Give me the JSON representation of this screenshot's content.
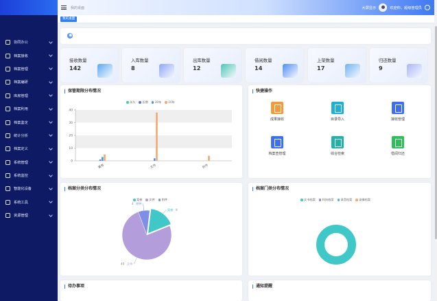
{
  "sidebar": {
    "items": [
      {
        "label": "协同办公",
        "icon": "settings-icon"
      },
      {
        "label": "档案接收",
        "icon": "inbox-icon"
      },
      {
        "label": "档案管理",
        "icon": "archive-icon"
      },
      {
        "label": "档案编研",
        "icon": "edit-icon"
      },
      {
        "label": "库房管理",
        "icon": "warehouse-icon"
      },
      {
        "label": "档案利用",
        "icon": "use-icon"
      },
      {
        "label": "档案鉴定",
        "icon": "appraise-icon"
      },
      {
        "label": "统计分析",
        "icon": "stats-icon"
      },
      {
        "label": "档案定义",
        "icon": "define-icon"
      },
      {
        "label": "系统管理",
        "icon": "system-icon"
      },
      {
        "label": "系统监控",
        "icon": "monitor-icon"
      },
      {
        "label": "智能化设备",
        "icon": "device-icon"
      },
      {
        "label": "系统工具",
        "icon": "tools-icon"
      },
      {
        "label": "资源管理",
        "icon": "resource-icon"
      }
    ]
  },
  "topbar": {
    "breadcrumb": "我的桌面",
    "bigscreen": "大屏显示",
    "welcome": "欢迎你，超级管理员"
  },
  "tabs": [
    {
      "label": "我的桌面"
    }
  ],
  "stats": [
    {
      "label": "接收数量",
      "value": "142",
      "color": "#5aa9f0"
    },
    {
      "label": "入库数量",
      "value": "8",
      "color": "#8fa6f6"
    },
    {
      "label": "出库数量",
      "value": "12",
      "color": "#4cc7b7"
    },
    {
      "label": "借阅数量",
      "value": "14",
      "color": "#4f8ef2"
    },
    {
      "label": "上架数量",
      "value": "17",
      "color": "#6fb4f2"
    },
    {
      "label": "归还数量",
      "value": "9",
      "color": "#a9b6f5"
    }
  ],
  "panels": {
    "retention": "保管期限分布情况",
    "quick": "快捷操作",
    "category": "档案分类分布情况",
    "door": "档案门类分布情况",
    "todo": "待办事项",
    "notice": "通知提醒"
  },
  "quick_actions": [
    {
      "label": "成果接收",
      "color": "#f29b38"
    },
    {
      "label": "目录导入",
      "color": "#1fb0d8"
    },
    {
      "label": "接收管理",
      "color": "#3e6ff2"
    },
    {
      "label": "档案查管理",
      "color": "#3e6ff2"
    },
    {
      "label": "综合检索",
      "color": "#21b3a8"
    },
    {
      "label": "借阅归还",
      "color": "#2fbf5a"
    }
  ],
  "chart_data": [
    {
      "type": "bar",
      "categories": [
        "案卷",
        "文件",
        "附件"
      ],
      "series": [
        {
          "name": "永久",
          "values": [
            0,
            0,
            0
          ],
          "color": "#4ec8b6"
        },
        {
          "name": "长期",
          "values": [
            1,
            0,
            0
          ],
          "color": "#5c7be0"
        },
        {
          "name": "30年",
          "values": [
            3,
            2,
            0
          ],
          "color": "#3d9be9"
        },
        {
          "name": "10年",
          "values": [
            5,
            38,
            4
          ],
          "color": "#f5a86f"
        }
      ],
      "yticks": [
        0,
        10,
        20,
        30,
        40
      ],
      "ylim": [
        0,
        40
      ]
    },
    {
      "type": "pie",
      "series": [
        {
          "name": "案卷",
          "value": 9,
          "color": "#40c8c8"
        },
        {
          "name": "文件",
          "value": 40,
          "color": "#b39ddb"
        },
        {
          "name": "附件",
          "value": 4,
          "color": "#7f8fe8"
        }
      ]
    },
    {
      "type": "pie",
      "legend": [
        {
          "name": "文书档案",
          "color": "#40c8c8"
        },
        {
          "name": "科技档案",
          "color": "#7f8fe8"
        },
        {
          "name": "录音档案",
          "color": "#5aa9f0"
        },
        {
          "name": "录像档案",
          "color": "#f5a86f"
        }
      ],
      "series": [
        {
          "name": "文书档案",
          "value": 100,
          "color": "#40c8c8"
        }
      ]
    }
  ]
}
